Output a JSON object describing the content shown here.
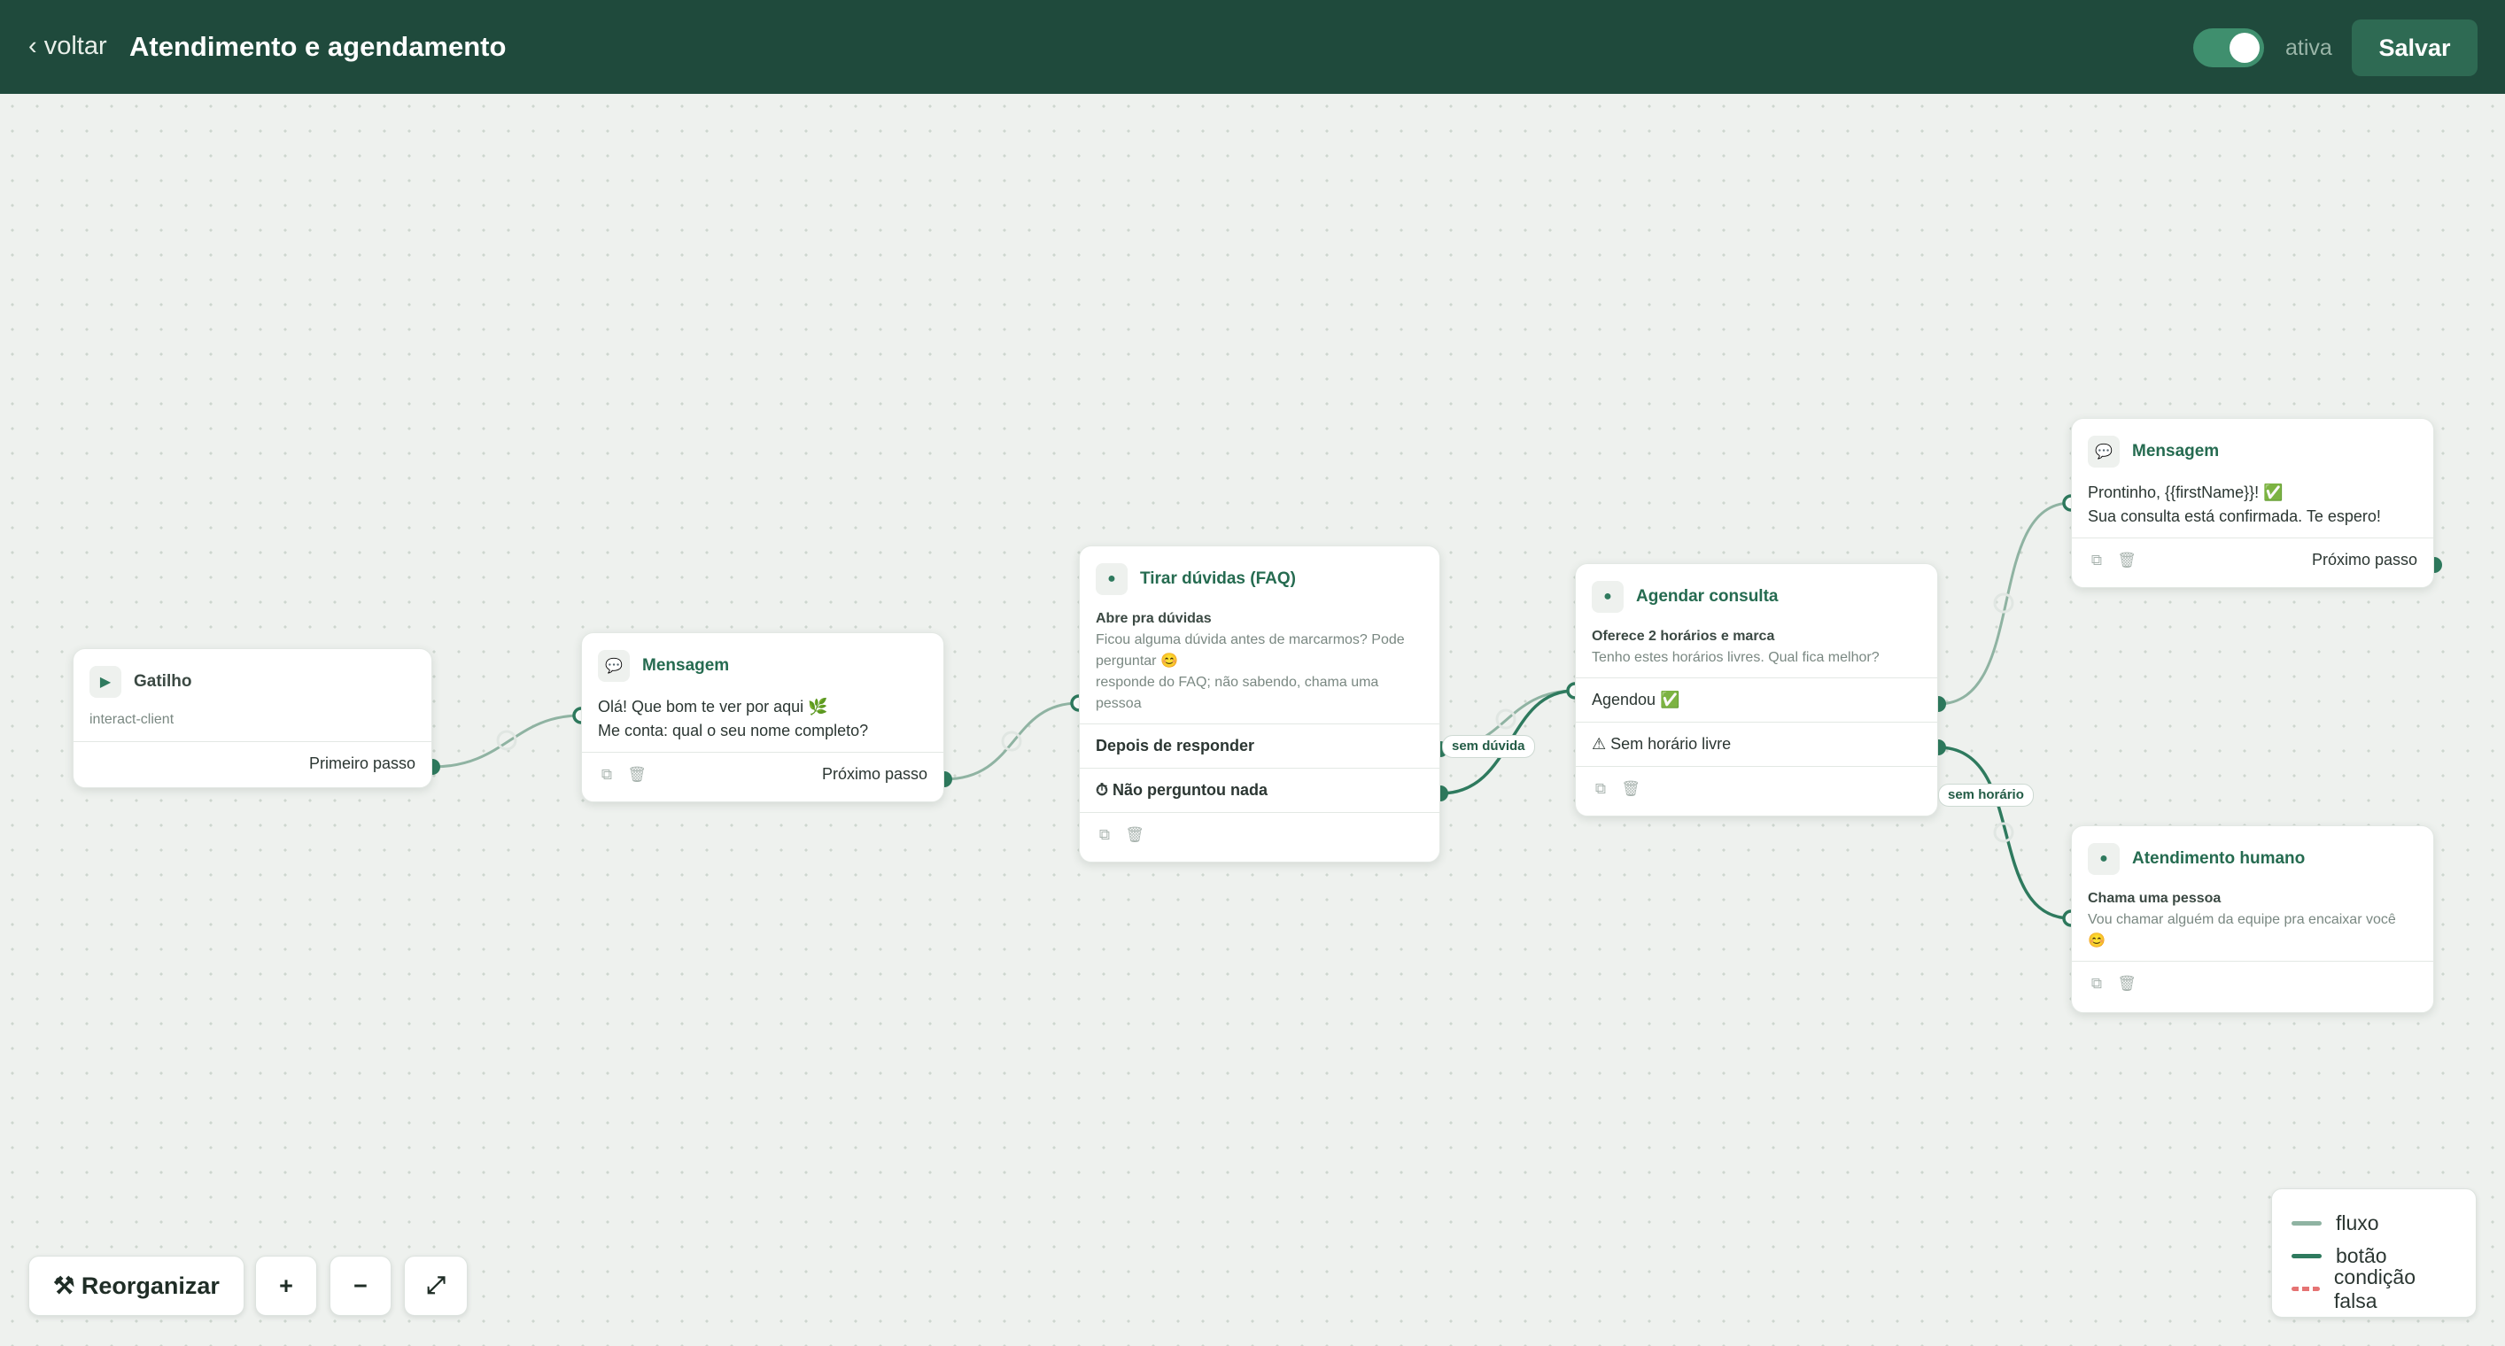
{
  "header": {
    "back_label": "‹ voltar",
    "title": "Atendimento e agendamento",
    "toggle_state": "on",
    "toggle_label": "ativa",
    "save_label": "Salvar"
  },
  "colors": {
    "header_bg": "#1f4a3c",
    "accent": "#2e6a53",
    "edge_flow": "#8fb3a2",
    "edge_button": "#2e7a5e",
    "edge_false": "#e57373"
  },
  "nodes": {
    "trigger": {
      "icon": "play-icon",
      "title": "Gatilho",
      "subtitle": "interact-client",
      "footer_label": "Primeiro passo"
    },
    "message1": {
      "icon": "chat-bubble-icon",
      "title": "Mensagem",
      "line1": "Olá! Que bom te ver por aqui 🌿",
      "line2": "Me conta: qual o seu nome completo?",
      "footer_label": "Próximo passo"
    },
    "faq": {
      "icon": "dot-icon",
      "title": "Tirar dúvidas (FAQ)",
      "heading": "Abre pra dúvidas",
      "text": "Ficou alguma dúvida antes de marcarmos? Pode perguntar 😊",
      "text2": "responde do FAQ; não sabendo, chama uma pessoa",
      "row1": "Depois de responder",
      "row2": "⏱ Não perguntou nada"
    },
    "schedule": {
      "icon": "dot-icon",
      "title": "Agendar consulta",
      "heading": "Oferece 2 horários e marca",
      "text": "Tenho estes horários livres. Qual fica melhor?",
      "row1": "Agendou ✅",
      "row2": "⚠ Sem horário livre"
    },
    "message2": {
      "icon": "chat-bubble-icon",
      "title": "Mensagem",
      "line1": "Prontinho, {{firstName}}! ✅",
      "line2": "Sua consulta está confirmada. Te espero!",
      "footer_label": "Próximo passo"
    },
    "human": {
      "icon": "dot-icon",
      "title": "Atendimento humano",
      "heading": "Chama uma pessoa",
      "text": "Vou chamar alguém da equipe pra encaixar você 😊"
    }
  },
  "edge_labels": {
    "no_question": "sem dúvida",
    "no_slot": "sem horário"
  },
  "controls": {
    "reorganize_label": "⚒ Reorganizar",
    "zoom_in_label": "+",
    "zoom_out_label": "−",
    "fit_label": "⤢"
  },
  "legend": {
    "items": [
      {
        "label": "fluxo",
        "color": "#8fb3a2"
      },
      {
        "label": "botão",
        "color": "#2e7a5e"
      },
      {
        "label": "condição falsa",
        "color": "#e57373"
      }
    ]
  }
}
